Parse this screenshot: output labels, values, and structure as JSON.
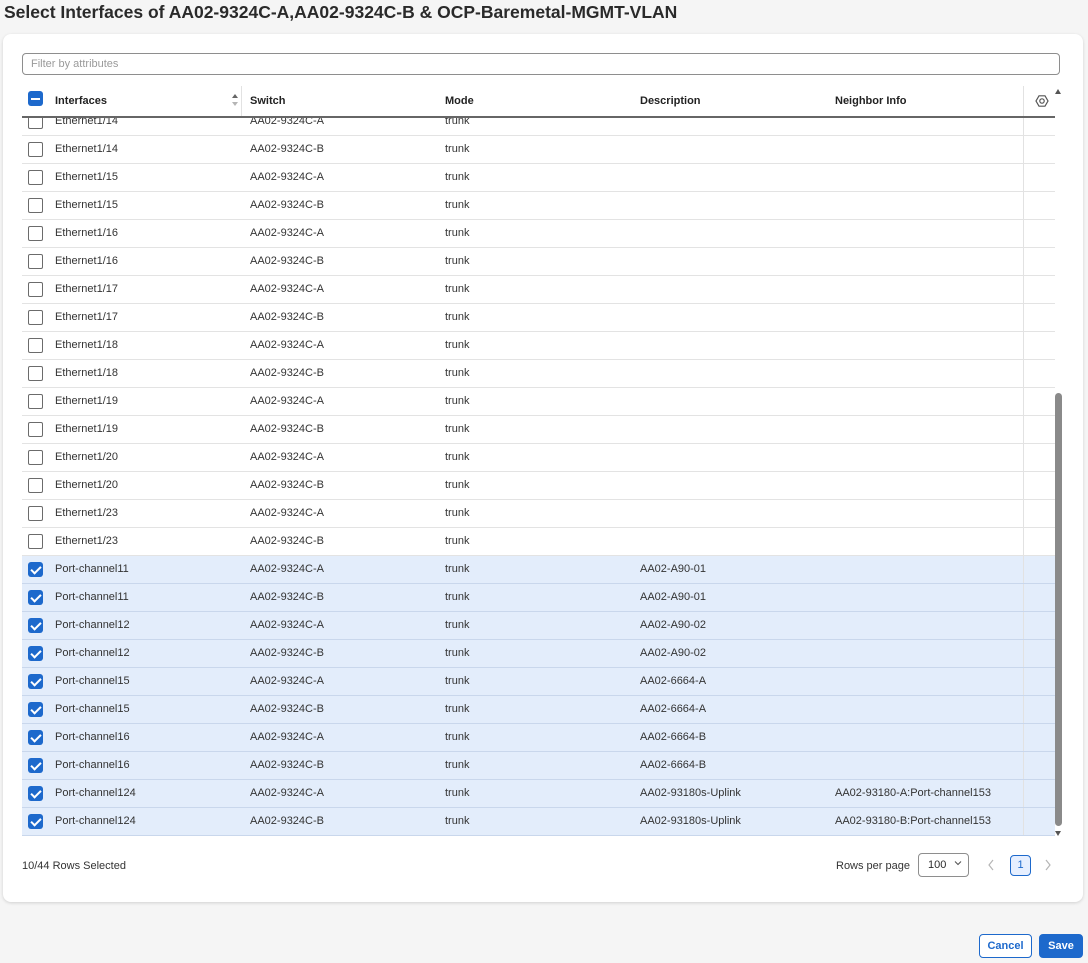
{
  "dialog": {
    "title": "Select Interfaces of AA02-9324C-A,AA02-9324C-B & OCP-Baremetal-MGMT-VLAN"
  },
  "filter": {
    "placeholder": "Filter by attributes",
    "value": ""
  },
  "table": {
    "columns": {
      "interfaces": "Interfaces",
      "switch": "Switch",
      "mode": "Mode",
      "description": "Description",
      "neighbor": "Neighbor Info"
    },
    "rows": [
      {
        "iface": "Ethernet1/14",
        "switch": "AA02-9324C-A",
        "mode": "trunk",
        "desc": "",
        "neighbor": "",
        "checked": false
      },
      {
        "iface": "Ethernet1/14",
        "switch": "AA02-9324C-B",
        "mode": "trunk",
        "desc": "",
        "neighbor": "",
        "checked": false
      },
      {
        "iface": "Ethernet1/15",
        "switch": "AA02-9324C-A",
        "mode": "trunk",
        "desc": "",
        "neighbor": "",
        "checked": false
      },
      {
        "iface": "Ethernet1/15",
        "switch": "AA02-9324C-B",
        "mode": "trunk",
        "desc": "",
        "neighbor": "",
        "checked": false
      },
      {
        "iface": "Ethernet1/16",
        "switch": "AA02-9324C-A",
        "mode": "trunk",
        "desc": "",
        "neighbor": "",
        "checked": false
      },
      {
        "iface": "Ethernet1/16",
        "switch": "AA02-9324C-B",
        "mode": "trunk",
        "desc": "",
        "neighbor": "",
        "checked": false
      },
      {
        "iface": "Ethernet1/17",
        "switch": "AA02-9324C-A",
        "mode": "trunk",
        "desc": "",
        "neighbor": "",
        "checked": false
      },
      {
        "iface": "Ethernet1/17",
        "switch": "AA02-9324C-B",
        "mode": "trunk",
        "desc": "",
        "neighbor": "",
        "checked": false
      },
      {
        "iface": "Ethernet1/18",
        "switch": "AA02-9324C-A",
        "mode": "trunk",
        "desc": "",
        "neighbor": "",
        "checked": false
      },
      {
        "iface": "Ethernet1/18",
        "switch": "AA02-9324C-B",
        "mode": "trunk",
        "desc": "",
        "neighbor": "",
        "checked": false
      },
      {
        "iface": "Ethernet1/19",
        "switch": "AA02-9324C-A",
        "mode": "trunk",
        "desc": "",
        "neighbor": "",
        "checked": false
      },
      {
        "iface": "Ethernet1/19",
        "switch": "AA02-9324C-B",
        "mode": "trunk",
        "desc": "",
        "neighbor": "",
        "checked": false
      },
      {
        "iface": "Ethernet1/20",
        "switch": "AA02-9324C-A",
        "mode": "trunk",
        "desc": "",
        "neighbor": "",
        "checked": false
      },
      {
        "iface": "Ethernet1/20",
        "switch": "AA02-9324C-B",
        "mode": "trunk",
        "desc": "",
        "neighbor": "",
        "checked": false
      },
      {
        "iface": "Ethernet1/23",
        "switch": "AA02-9324C-A",
        "mode": "trunk",
        "desc": "",
        "neighbor": "",
        "checked": false
      },
      {
        "iface": "Ethernet1/23",
        "switch": "AA02-9324C-B",
        "mode": "trunk",
        "desc": "",
        "neighbor": "",
        "checked": false
      },
      {
        "iface": "Port-channel11",
        "switch": "AA02-9324C-A",
        "mode": "trunk",
        "desc": "AA02-A90-01",
        "neighbor": "",
        "checked": true
      },
      {
        "iface": "Port-channel11",
        "switch": "AA02-9324C-B",
        "mode": "trunk",
        "desc": "AA02-A90-01",
        "neighbor": "",
        "checked": true
      },
      {
        "iface": "Port-channel12",
        "switch": "AA02-9324C-A",
        "mode": "trunk",
        "desc": "AA02-A90-02",
        "neighbor": "",
        "checked": true
      },
      {
        "iface": "Port-channel12",
        "switch": "AA02-9324C-B",
        "mode": "trunk",
        "desc": "AA02-A90-02",
        "neighbor": "",
        "checked": true
      },
      {
        "iface": "Port-channel15",
        "switch": "AA02-9324C-A",
        "mode": "trunk",
        "desc": "AA02-6664-A",
        "neighbor": "",
        "checked": true
      },
      {
        "iface": "Port-channel15",
        "switch": "AA02-9324C-B",
        "mode": "trunk",
        "desc": "AA02-6664-A",
        "neighbor": "",
        "checked": true
      },
      {
        "iface": "Port-channel16",
        "switch": "AA02-9324C-A",
        "mode": "trunk",
        "desc": "AA02-6664-B",
        "neighbor": "",
        "checked": true
      },
      {
        "iface": "Port-channel16",
        "switch": "AA02-9324C-B",
        "mode": "trunk",
        "desc": "AA02-6664-B",
        "neighbor": "",
        "checked": true
      },
      {
        "iface": "Port-channel124",
        "switch": "AA02-9324C-A",
        "mode": "trunk",
        "desc": "AA02-93180s-Uplink",
        "neighbor": "AA02-93180-A:Port-channel153",
        "checked": true
      },
      {
        "iface": "Port-channel124",
        "switch": "AA02-9324C-B",
        "mode": "trunk",
        "desc": "AA02-93180s-Uplink",
        "neighbor": "AA02-93180-B:Port-channel153",
        "checked": true
      }
    ]
  },
  "footer": {
    "selection_status": "10/44 Rows Selected",
    "rows_per_page_label": "Rows per page",
    "rows_per_page_value": "100",
    "current_page": "1"
  },
  "actions": {
    "cancel_label": "Cancel",
    "save_label": "Save"
  },
  "icons": {
    "header_checkbox": "indeterminate-checkbox-icon",
    "sort": "sort-icon",
    "settings": "settings-icon",
    "chevron": "chevron-down-icon",
    "prev": "chevron-left-icon",
    "next": "chevron-right-icon"
  },
  "colors": {
    "accent": "#1d69cc",
    "selected_row": "#e3edfb"
  }
}
